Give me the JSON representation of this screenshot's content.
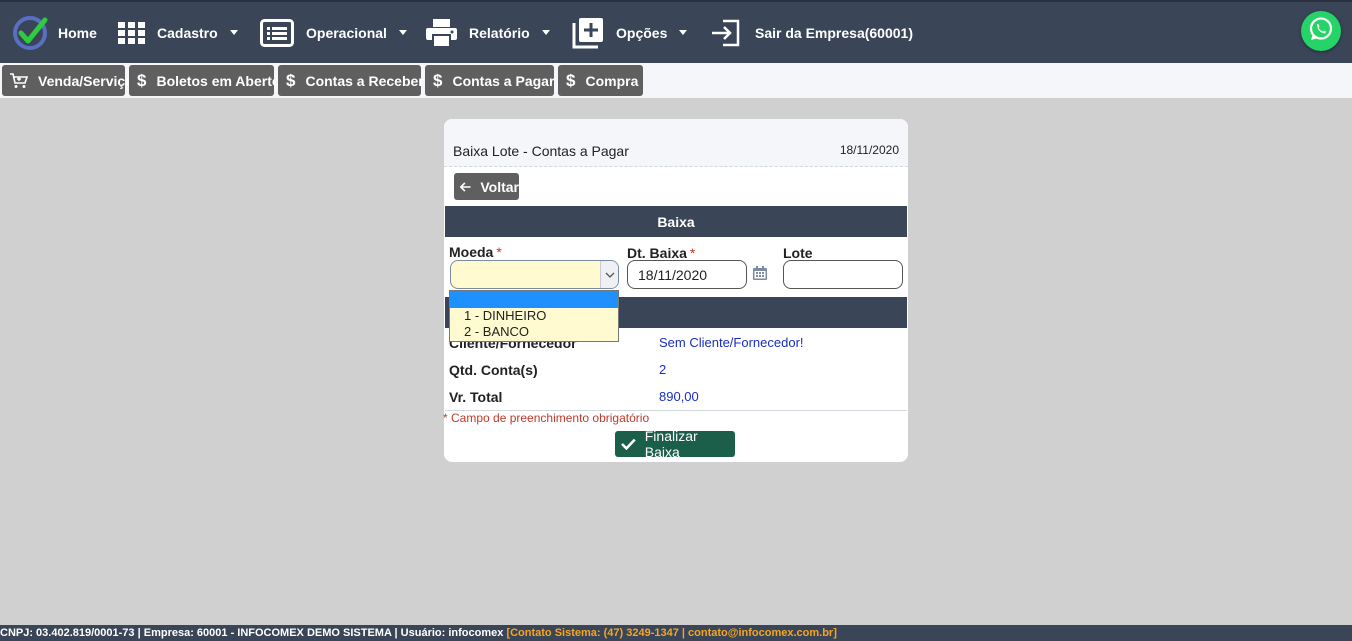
{
  "nav": {
    "home": "Home",
    "cadastro": "Cadastro",
    "operacional": "Operacional",
    "relatorio": "Relatório",
    "opcoes": "Opções",
    "sair": "Sair da Empresa(60001)",
    "brand_color": "#3a4558",
    "whatsapp_color": "#25d366"
  },
  "shortcuts": [
    {
      "label": "Venda/Serviço",
      "icon": "cart-icon"
    },
    {
      "label": "Boletos em Aberto",
      "icon": "dollar-icon"
    },
    {
      "label": "Contas a Receber",
      "icon": "dollar-icon"
    },
    {
      "label": "Contas a Pagar",
      "icon": "dollar-icon"
    },
    {
      "label": "Compra",
      "icon": "dollar-icon"
    }
  ],
  "panel": {
    "title": "Baixa Lote - Contas a Pagar",
    "date": "18/11/2020",
    "back_label": "Voltar",
    "section_baixa": "Baixa",
    "moeda_label": "Moeda",
    "dt_baixa_label": "Dt. Baixa",
    "lote_label": "Lote",
    "required_mark": "*",
    "moeda_value": "",
    "dt_baixa_value": "18/11/2020",
    "lote_value": "",
    "moeda_options": [
      "",
      "1 - DINHEIRO",
      "2 - BANCO"
    ],
    "cliente_label": "Cliente/Fornecedor",
    "cliente_value": "Sem Cliente/Fornecedor!",
    "qtd_label": "Qtd. Conta(s)",
    "qtd_value": "2",
    "total_label": "Vr. Total",
    "total_value": "890,00",
    "required_note": "* Campo de preenchimento obrigatório",
    "finalize_label": "Finalizar Baixa"
  },
  "footer": {
    "info": "CNPJ: 03.402.819/0001-73 | Empresa: 60001 - INFOCOMEX DEMO SISTEMA | Usuário: infocomex ",
    "contact": "[Contato Sistema: (47) 3249-1347 | contato@infocomex.com.br]"
  }
}
